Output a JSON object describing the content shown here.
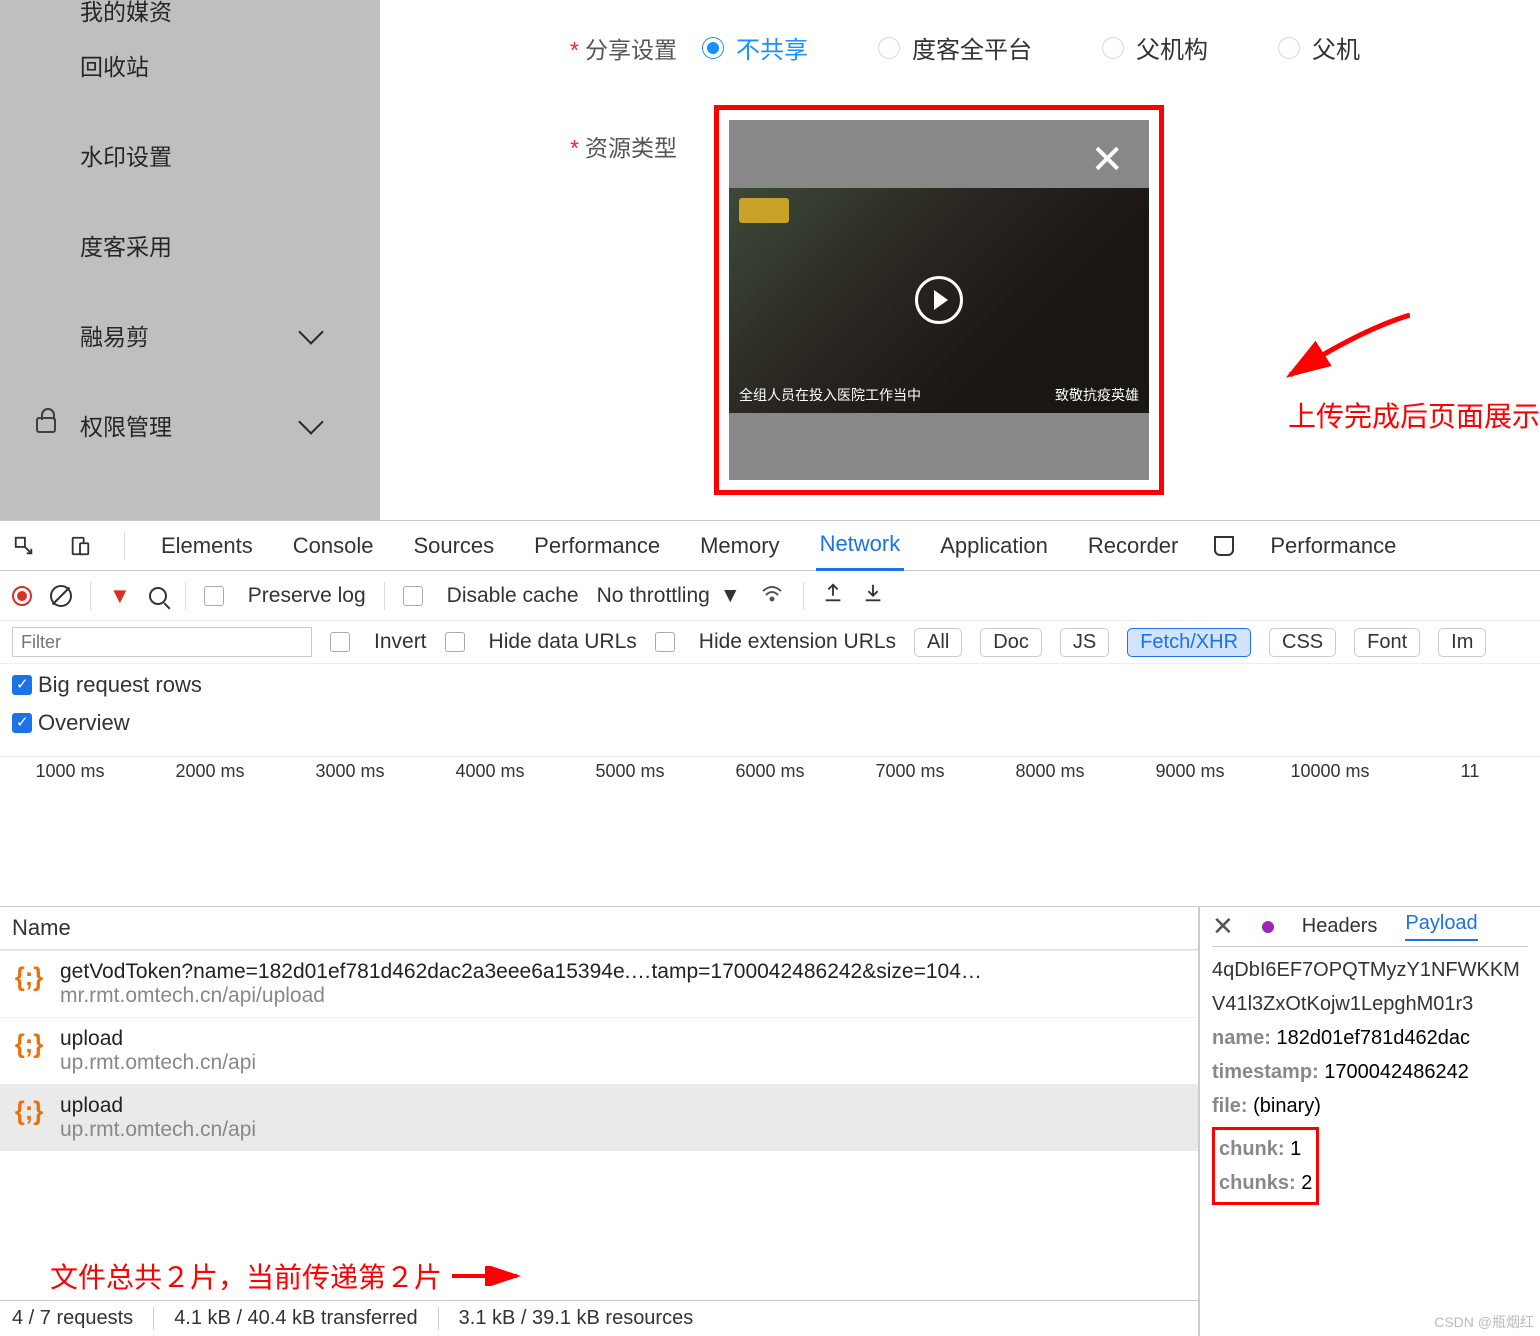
{
  "sidebar": {
    "items": [
      {
        "label": "我的媒资"
      },
      {
        "label": "回收站"
      },
      {
        "label": "水印设置"
      },
      {
        "label": "度客采用"
      },
      {
        "label": "融易剪"
      },
      {
        "label": "权限管理"
      }
    ]
  },
  "form": {
    "share_label": "分享设置",
    "type_label": "资源类型",
    "radios": [
      {
        "label": "不共享",
        "sel": true
      },
      {
        "label": "度客全平台",
        "sel": false
      },
      {
        "label": "父机构",
        "sel": false
      },
      {
        "label": "父机",
        "sel": false
      }
    ],
    "thumb_subtitle_left": "全组人员在投入医院工作当中",
    "thumb_subtitle_right": "致敬抗疫英雄"
  },
  "annot": {
    "a1": "上传完成后页面展示",
    "a2": "文件总共２片，当前传递第２片"
  },
  "devtools": {
    "tabs": [
      "Elements",
      "Console",
      "Sources",
      "Performance",
      "Memory",
      "Network",
      "Application",
      "Recorder",
      "Performance"
    ],
    "active_tab": "Network",
    "preserve_log": "Preserve log",
    "disable_cache": "Disable cache",
    "throttling": "No throttling",
    "filter_placeholder": "Filter",
    "invert": "Invert",
    "hide_data": "Hide data URLs",
    "hide_ext": "Hide extension URLs",
    "chips": [
      "All",
      "Doc",
      "JS",
      "Fetch/XHR",
      "CSS",
      "Font",
      "Im"
    ],
    "active_chip": "Fetch/XHR",
    "big_rows": "Big request rows",
    "overview": "Overview",
    "ticks": [
      "1000 ms",
      "2000 ms",
      "3000 ms",
      "4000 ms",
      "5000 ms",
      "6000 ms",
      "7000 ms",
      "8000 ms",
      "9000 ms",
      "10000 ms",
      "11"
    ],
    "name_col": "Name",
    "requests": [
      {
        "name": "getVodToken?name=182d01ef781d462dac2a3eee6a15394e.…tamp=1700042486242&size=104…",
        "url": "mr.rmt.omtech.cn/api/upload",
        "sel": false
      },
      {
        "name": "upload",
        "url": "up.rmt.omtech.cn/api",
        "sel": false
      },
      {
        "name": "upload",
        "url": "up.rmt.omtech.cn/api",
        "sel": true
      }
    ],
    "footer": {
      "req": "4 / 7 requests",
      "trans": "4.1 kB / 40.4 kB transferred",
      "res": "3.1 kB / 39.1 kB resources"
    },
    "detail": {
      "headers_tab": "Headers",
      "payload_tab": "Payload",
      "lines": [
        {
          "raw": "4qDbI6EF7OPQTMyzY1NFWKKM"
        },
        {
          "raw": "V41l3ZxOtKojw1LepghM01r3"
        },
        {
          "k": "name:",
          "v": "182d01ef781d462dac"
        },
        {
          "k": "timestamp:",
          "v": "1700042486242"
        },
        {
          "k": "file:",
          "v": "(binary)"
        }
      ],
      "boxed": [
        {
          "k": "chunk:",
          "v": "1"
        },
        {
          "k": "chunks:",
          "v": "2"
        }
      ]
    },
    "watermark": "CSDN @瓶烟红"
  }
}
